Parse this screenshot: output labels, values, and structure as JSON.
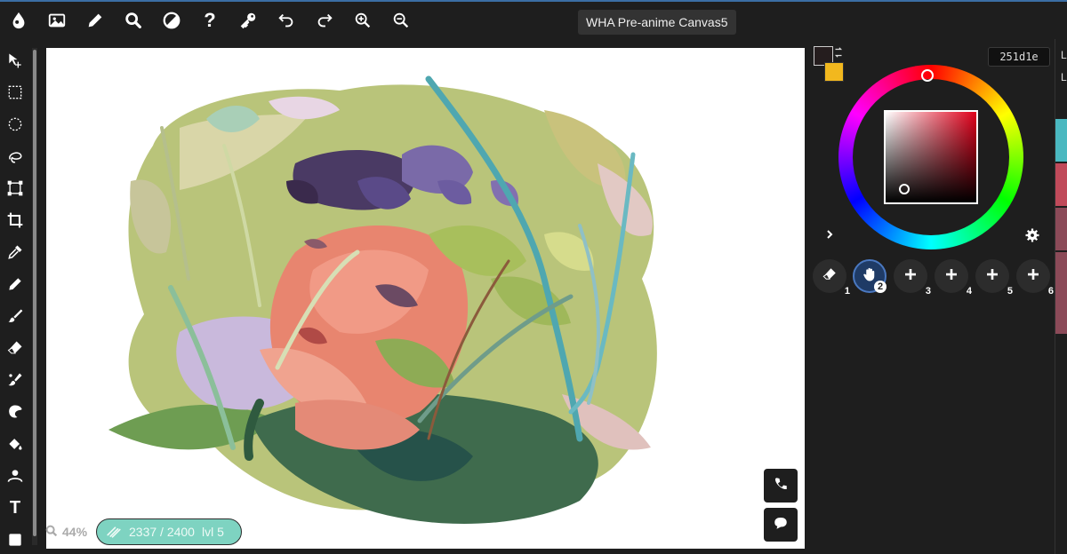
{
  "toolbar": {
    "icons": [
      "app-logo",
      "image",
      "pencil-edit",
      "search",
      "contrast",
      "help",
      "key",
      "undo",
      "redo",
      "zoom-in",
      "zoom-out"
    ],
    "canvas_title": "WHA Pre-anime Canvas5"
  },
  "tools": {
    "icons": [
      "move",
      "rect-select",
      "ellipse-select",
      "lasso",
      "transform",
      "crop",
      "eyedropper",
      "pencil",
      "brush",
      "eraser",
      "smudge",
      "blend",
      "fill",
      "shape",
      "text",
      "color"
    ]
  },
  "status": {
    "zoom_label": "44%",
    "xp_label": "2337 / 2400",
    "level_label": "lvl 5"
  },
  "color_panel": {
    "primary_color": "#251d1e",
    "secondary_color": "#f2b81e",
    "hex_value": "251d1e",
    "hue_color": "#e0001a"
  },
  "brush_slots": [
    {
      "num": "1",
      "icon": "eraser-icon"
    },
    {
      "num": "2",
      "icon": "hand-icon"
    },
    {
      "num": "3",
      "icon": "plus-icon"
    },
    {
      "num": "4",
      "icon": "plus-icon"
    },
    {
      "num": "5",
      "icon": "plus-icon"
    },
    {
      "num": "6",
      "icon": "plus-icon"
    }
  ],
  "layers_panel": {
    "edge_label_1": "L",
    "edge_label_2": "L",
    "layer_colors": [
      "#4ab8c0",
      "#c04a5a",
      "#8b4a58",
      "#8b4a58"
    ]
  },
  "colors": {
    "accent": "#3b6ea5",
    "xp_bar": "#7ed3c1",
    "background": "#1e1e1e"
  }
}
